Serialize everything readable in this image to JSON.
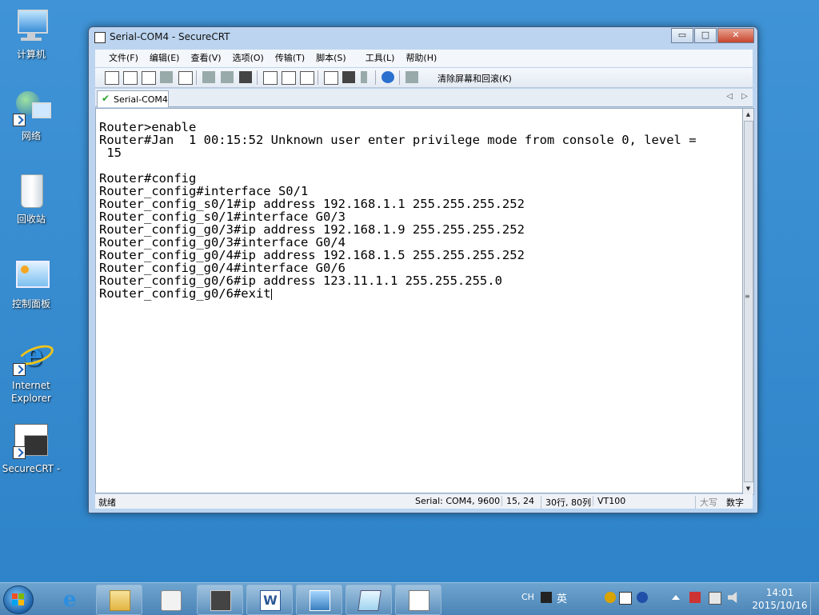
{
  "desktop": {
    "icons": [
      {
        "label": "计算机",
        "icon": "computer-icon"
      },
      {
        "label": "网络",
        "icon": "network-icon"
      },
      {
        "label": "回收站",
        "icon": "recycle-bin-icon"
      },
      {
        "label": "控制面板",
        "icon": "control-panel-icon"
      },
      {
        "label": "Internet Explorer",
        "icon": "internet-explorer-icon"
      },
      {
        "label": "SecureCRT -",
        "icon": "securecrt-icon"
      }
    ]
  },
  "window": {
    "title": "Serial-COM4 - SecureCRT",
    "buttons": {
      "minimize": "▭",
      "maximize": "□",
      "close": "✕"
    },
    "menu": [
      "文件(F)",
      "编辑(E)",
      "查看(V)",
      "选项(O)",
      "传输(T)",
      "脚本(S)",
      "工具(L)",
      "帮助(H)"
    ],
    "toolbar": {
      "clear_label": "清除屏幕和回滚(K)"
    },
    "tab": {
      "label": "Serial-COM4",
      "status_icon": "check-icon"
    },
    "tabnav": {
      "prev": "◁",
      "next": "▷"
    },
    "terminal": {
      "lines": [
        "Router>enable",
        "Router#Jan  1 00:15:52 Unknown user enter privilege mode from console 0, level =",
        " 15",
        "",
        "Router#config",
        "Router_config#interface S0/1",
        "Router_config_s0/1#ip address 192.168.1.1 255.255.255.252",
        "Router_config_s0/1#interface G0/3",
        "Router_config_g0/3#ip address 192.168.1.9 255.255.255.252",
        "Router_config_g0/3#interface G0/4",
        "Router_config_g0/4#ip address 192.168.1.5 255.255.255.252",
        "Router_config_g0/4#interface G0/6",
        "Router_config_g0/6#ip address 123.11.1.1 255.255.255.0",
        "Router_config_g0/6#exit"
      ]
    },
    "scrollbar": {
      "up": "▲",
      "down": "▼",
      "grip": "≡"
    },
    "status": {
      "ready": "就绪",
      "connection": "Serial: COM4, 9600",
      "cursor_pos": "15,  24",
      "size": "30行, 80列",
      "terminal_type": "VT100",
      "caps": "大写",
      "num": "数字"
    }
  },
  "taskbar": {
    "apps": [
      "internet-explorer-icon",
      "file-explorer-icon",
      "media-player-icon",
      "securecrt-icon",
      "word-icon",
      "image-viewer-icon",
      "notepad-icon",
      "document-icon"
    ],
    "tray": {
      "lang": "CH",
      "ime": "英"
    },
    "clock": {
      "time": "14:01",
      "date": "2015/10/16"
    }
  }
}
